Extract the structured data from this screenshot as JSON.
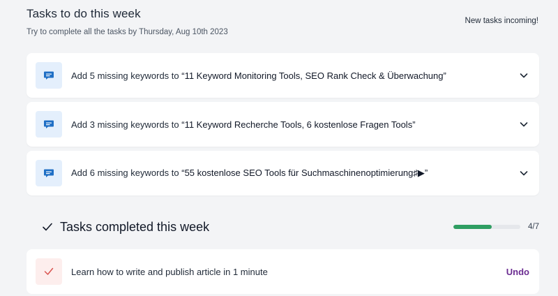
{
  "header": {
    "title": "Tasks to do this week",
    "subtitle": "Try to complete all the tasks by Thursday, Aug 10th 2023",
    "incoming": "New tasks incoming!"
  },
  "tasks": [
    {
      "prefix": "Add 5 missing keywords to ",
      "keyword": "“11 Keyword Monitoring Tools, SEO Rank Check & Überwachung”",
      "icon": "chat-bubble-icon"
    },
    {
      "prefix": "Add 3 missing keywords to ",
      "keyword": "“11 Keyword Recherche Tools, 6 kostenlose Fragen Tools”",
      "icon": "chat-bubble-icon"
    },
    {
      "prefix": "Add 6 missing keywords to ",
      "keyword": "“55 kostenlose SEO Tools für Suchmaschinenoptimierung♯▶”",
      "icon": "chat-bubble-icon"
    }
  ],
  "completed": {
    "title": "Tasks completed this week",
    "progress_text": "4/7",
    "progress_fraction": 0.571,
    "progress_color": "#2f9e62",
    "items": [
      {
        "label": "Learn how to write and publish article in 1 minute",
        "action": "Undo",
        "icon": "checkmark-icon"
      }
    ]
  },
  "colors": {
    "accent": "#6b2c91",
    "icon_bg_blue": "#e4effc",
    "icon_blue": "#1f6fc5",
    "icon_bg_red": "#fdeeed",
    "check_red": "#d9534f"
  }
}
